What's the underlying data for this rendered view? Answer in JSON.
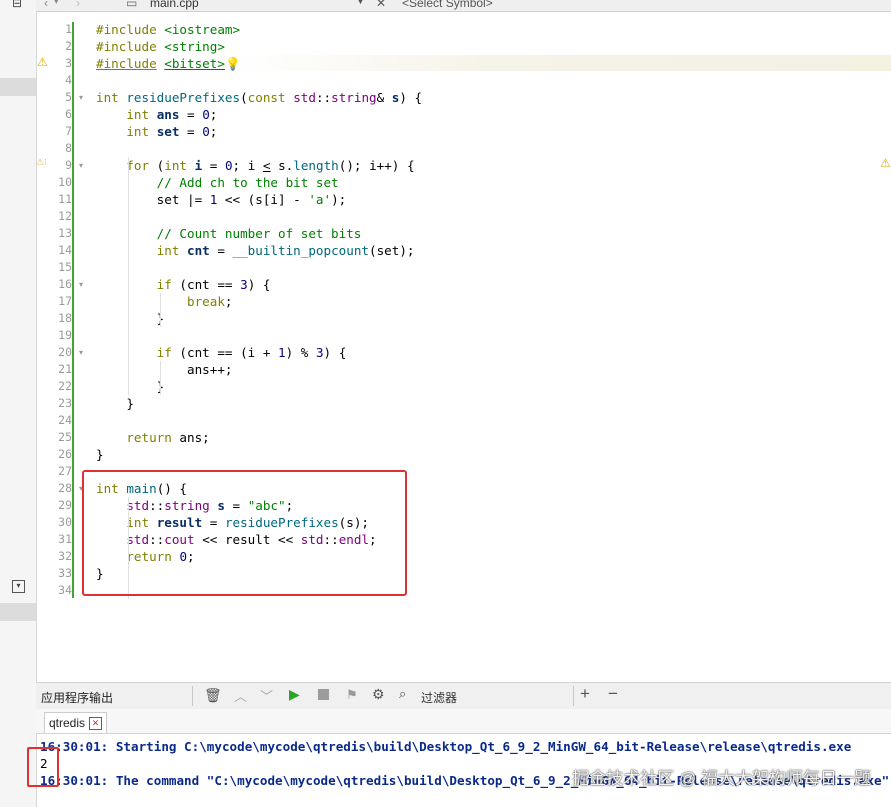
{
  "toolbar": {
    "file_name": "main.cpp",
    "symbol_placeholder": "<Select Symbol>"
  },
  "editor": {
    "lines": [
      {
        "n": "1",
        "html": "<span class='kw'>#include</span> <span class='str'>&lt;iostream&gt;</span>"
      },
      {
        "n": "2",
        "html": "<span class='kw'>#include</span> <span class='str'>&lt;string&gt;</span>"
      },
      {
        "n": "3",
        "html": "<span class='kw' style='text-decoration:underline'>#include</span> <span class='str' style='text-decoration:underline'>&lt;bitset&gt;</span><span style='color:#e0a800'>💡</span>"
      },
      {
        "n": "4",
        "html": ""
      },
      {
        "n": "5",
        "html": "<span class='kw'>int</span> <span class='fn'>residuePrefixes</span>(<span class='kw'>const</span> <span class='ty'>std</span>::<span class='ty'>string</span>&amp; <span class='bd'>s</span>) {"
      },
      {
        "n": "6",
        "html": "    <span class='kw'>int</span> <span class='bd'>ans</span> = <span class='num'>0</span>;"
      },
      {
        "n": "7",
        "html": "    <span class='kw'>int</span> <span class='bd'>set</span> = <span class='num'>0</span>;"
      },
      {
        "n": "8",
        "html": ""
      },
      {
        "n": "9",
        "html": "    <span class='kw'>for</span> (<span class='kw'>int</span> <span class='bd'>i</span> = <span class='num'>0</span>; i <span style='text-decoration:underline'>&lt;</span> s.<span class='fn'>length</span>(); i++) {"
      },
      {
        "n": "10",
        "html": "        <span class='cm'>// Add ch to the bit set</span>"
      },
      {
        "n": "11",
        "html": "        set |= <span class='num'>1</span> &lt;&lt; (s[i] - <span class='str'>'a'</span>);"
      },
      {
        "n": "12",
        "html": ""
      },
      {
        "n": "13",
        "html": "        <span class='cm'>// Count number of set bits</span>"
      },
      {
        "n": "14",
        "html": "        <span class='kw'>int</span> <span class='bd'>cnt</span> = <span class='fn'>__builtin_popcount</span>(set);"
      },
      {
        "n": "15",
        "html": ""
      },
      {
        "n": "16",
        "html": "        <span class='kw'>if</span> (cnt == <span class='num'>3</span>) {"
      },
      {
        "n": "17",
        "html": "            <span class='kw'>break</span>;"
      },
      {
        "n": "18",
        "html": "        }"
      },
      {
        "n": "19",
        "html": ""
      },
      {
        "n": "20",
        "html": "        <span class='kw'>if</span> (cnt == (i + <span class='num'>1</span>) % <span class='num'>3</span>) {"
      },
      {
        "n": "21",
        "html": "            ans++;"
      },
      {
        "n": "22",
        "html": "        }"
      },
      {
        "n": "23",
        "html": "    }"
      },
      {
        "n": "24",
        "html": ""
      },
      {
        "n": "25",
        "html": "    <span class='kw'>return</span> ans;"
      },
      {
        "n": "26",
        "html": "}"
      },
      {
        "n": "27",
        "html": ""
      },
      {
        "n": "28",
        "html": "<span class='kw'>int</span> <span class='fn'>main</span>() {"
      },
      {
        "n": "29",
        "html": "    <span class='ty'>std</span>::<span class='ty'>string</span> <span class='bd'>s</span> = <span class='str'>\"abc\"</span>;"
      },
      {
        "n": "30",
        "html": "    <span class='kw'>int</span> <span class='bd'>result</span> = <span class='fn'>residuePrefixes</span>(s);"
      },
      {
        "n": "31",
        "html": "    <span class='ty'>std</span>::<span class='ty'>cout</span> &lt;&lt; result &lt;&lt; <span class='ty'>std</span>::<span class='ty'>endl</span>;"
      },
      {
        "n": "32",
        "html": "    <span class='kw'>return</span> <span class='num'>0</span>;"
      },
      {
        "n": "33",
        "html": "}"
      },
      {
        "n": "34",
        "html": ""
      }
    ]
  },
  "output": {
    "panel_title": "应用程序输出",
    "filter_label": "过滤器",
    "tab_label": "qtredis",
    "tab_close": "✕",
    "lines": [
      "16:30:01: Starting C:\\mycode\\mycode\\qtredis\\build\\Desktop_Qt_6_9_2_MinGW_64_bit-Release\\release\\qtredis.exe",
      "2",
      "16:30:01: The command \"C:\\mycode\\mycode\\qtredis\\build\\Desktop_Qt_6_9_2_MinGW_64_bit-Release\\release\\qtredis.exe\""
    ]
  },
  "watermark": "掘金技术社区 @ 福大大架构师每日一题",
  "icons": [
    "back-icon",
    "forward-icon",
    "file-icon",
    "dropdown-icon",
    "close-icon",
    "warning-icon",
    "bulb-icon",
    "trash-icon",
    "up-icon",
    "down-icon",
    "run-icon",
    "stop-icon",
    "build-icon",
    "gear-icon",
    "search-icon",
    "plus-icon",
    "minus-icon"
  ],
  "colors": {
    "highlight_box": "#e03131",
    "change_bar": "#3fa535",
    "keyword": "#808000",
    "type": "#800080",
    "function": "#00677c",
    "string": "#008000",
    "number": "#000080",
    "output_text": "#0a2a8a"
  }
}
